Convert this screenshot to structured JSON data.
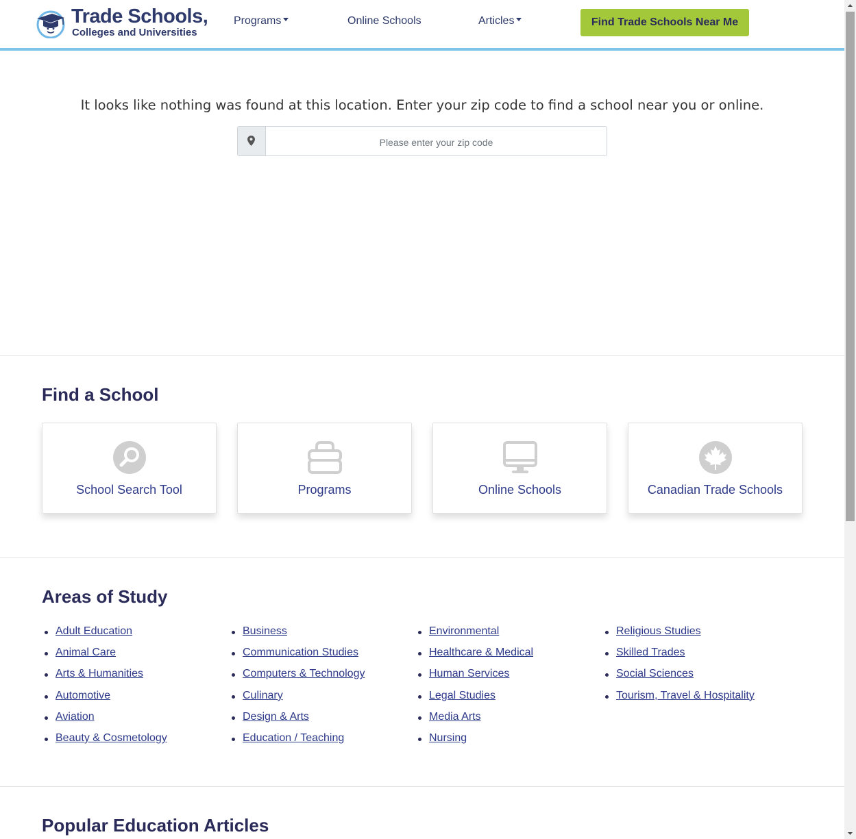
{
  "header": {
    "logo_title": "Trade Schools,",
    "logo_subtitle": "Colleges and Universities",
    "nav": {
      "programs": "Programs",
      "online_schools": "Online Schools",
      "articles": "Articles"
    },
    "cta_label": "Find Trade Schools Near Me"
  },
  "not_found": {
    "message": "It looks like nothing was found at this location. Enter your zip code to find a school near you or online.",
    "zip_placeholder": "Please enter your zip code"
  },
  "find_school": {
    "title": "Find a School",
    "cards": [
      {
        "label": "School Search Tool",
        "icon": "magnifier-icon"
      },
      {
        "label": "Programs",
        "icon": "toolbox-icon"
      },
      {
        "label": "Online Schools",
        "icon": "monitor-icon"
      },
      {
        "label": "Canadian Trade Schools",
        "icon": "maple-leaf-icon"
      }
    ]
  },
  "areas_of_study": {
    "title": "Areas of Study",
    "columns": [
      [
        "Adult Education",
        "Animal Care",
        "Arts & Humanities",
        "Automotive",
        "Aviation",
        "Beauty & Cosmetology"
      ],
      [
        "Business",
        "Communication Studies",
        "Computers & Technology",
        "Culinary",
        "Design & Arts",
        "Education / Teaching"
      ],
      [
        "Environmental",
        "Healthcare & Medical",
        "Human Services",
        "Legal Studies",
        "Media Arts",
        "Nursing"
      ],
      [
        "Religious Studies",
        "Skilled Trades",
        "Social Sciences",
        "Tourism, Travel & Hospitality"
      ]
    ]
  },
  "popular_articles": {
    "title": "Popular Education Articles"
  },
  "colors": {
    "accent_green": "#a3c93a",
    "header_border": "#7ec3ea",
    "navy": "#2b2b5a",
    "link": "#2e3a8a"
  }
}
